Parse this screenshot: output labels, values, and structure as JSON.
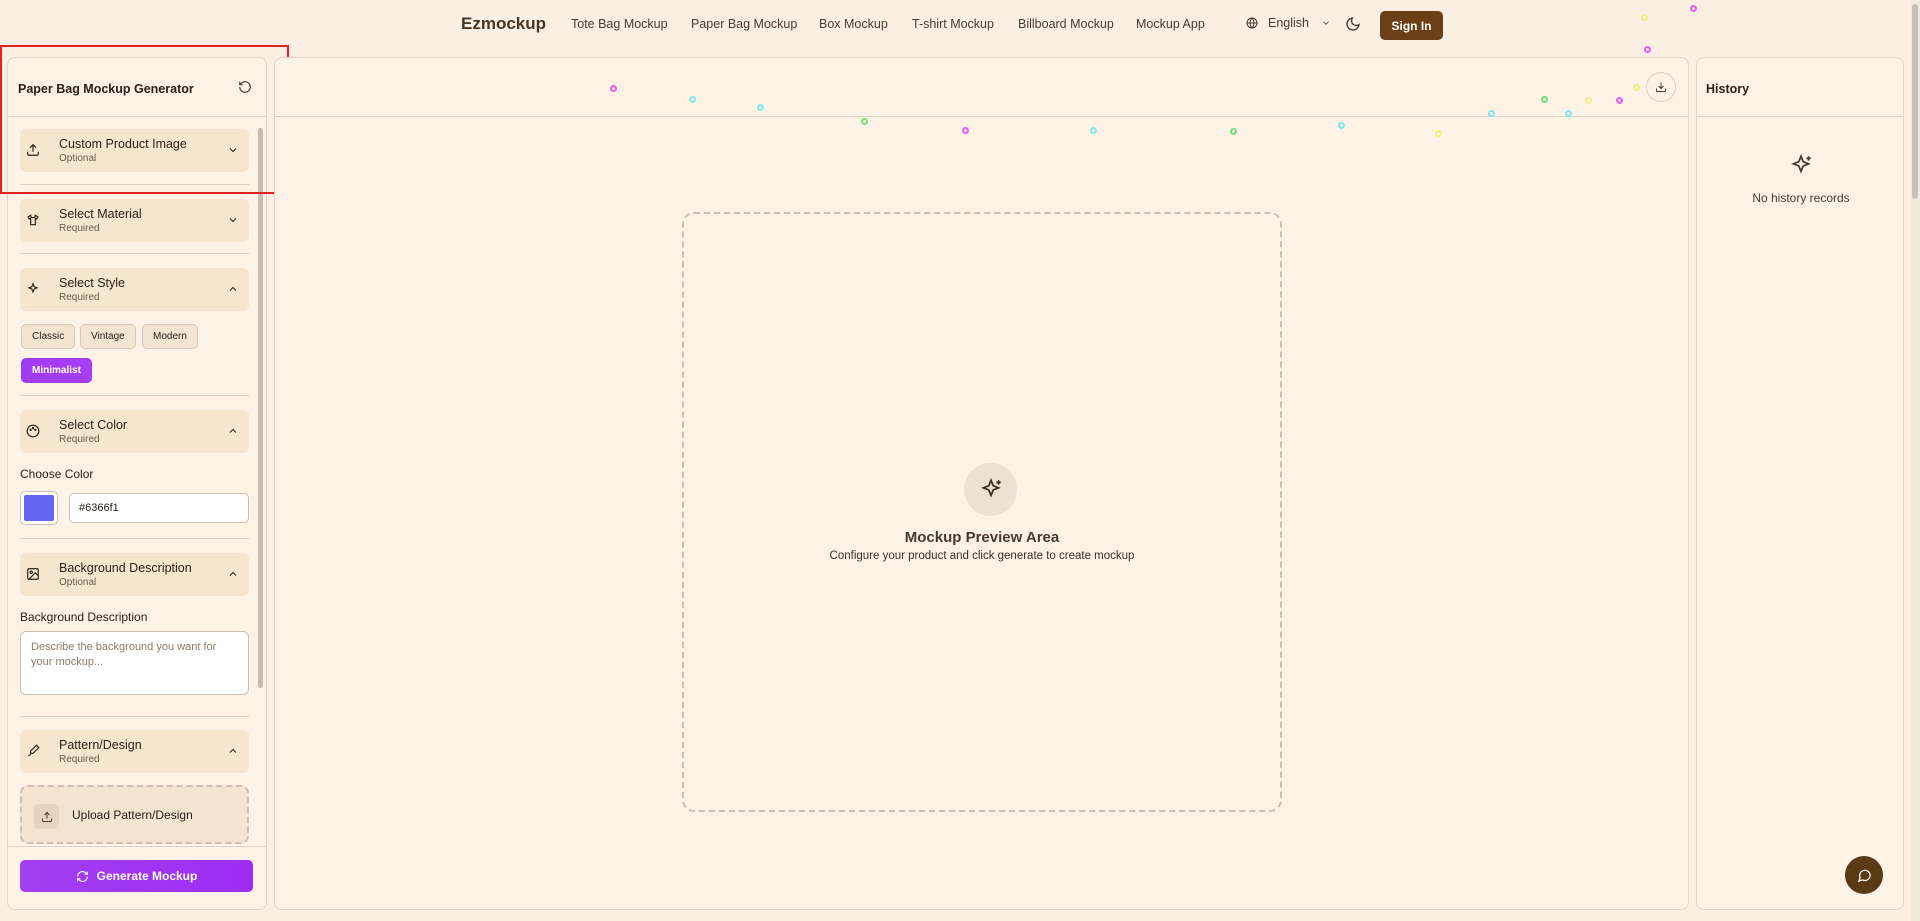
{
  "nav": {
    "brand": "Ezmockup",
    "links": [
      "Tote Bag Mockup",
      "Paper Bag Mockup",
      "Box Mockup",
      "T-shirt Mockup",
      "Billboard Mockup",
      "Mockup App"
    ],
    "language": "English",
    "sign_in": "Sign In"
  },
  "left": {
    "title": "Paper Bag Mockup Generator",
    "sections": [
      {
        "title": "Custom Product Image",
        "sub": "Optional",
        "icon": "upload-icon"
      },
      {
        "title": "Select Material",
        "sub": "Required",
        "icon": "shirt-icon"
      },
      {
        "title": "Select Style",
        "sub": "Required",
        "icon": "sparkles-icon"
      },
      {
        "title": "Select Color",
        "sub": "Required",
        "icon": "palette-icon"
      },
      {
        "title": "Background Description",
        "sub": "Optional",
        "icon": "image-icon"
      },
      {
        "title": "Pattern/Design",
        "sub": "Required",
        "icon": "brush-icon"
      }
    ],
    "styles": [
      "Classic",
      "Vintage",
      "Modern",
      "Minimalist"
    ],
    "selected_style": "Minimalist",
    "color_label": "Choose Color",
    "color_value": "#6366f1",
    "bg_label": "Background Description",
    "bg_placeholder": "Describe the background you want for your mockup...",
    "upload_pattern": "Upload Pattern/Design",
    "generate": "Generate Mockup"
  },
  "center": {
    "preview_title": "Mockup Preview Area",
    "preview_sub": "Configure your product and click generate to create mockup"
  },
  "right": {
    "title": "History",
    "empty": "No history records"
  },
  "colors": {
    "accent": "#9f3cf0",
    "brand_brown": "#6b3f17",
    "background": "#fbefe3"
  }
}
